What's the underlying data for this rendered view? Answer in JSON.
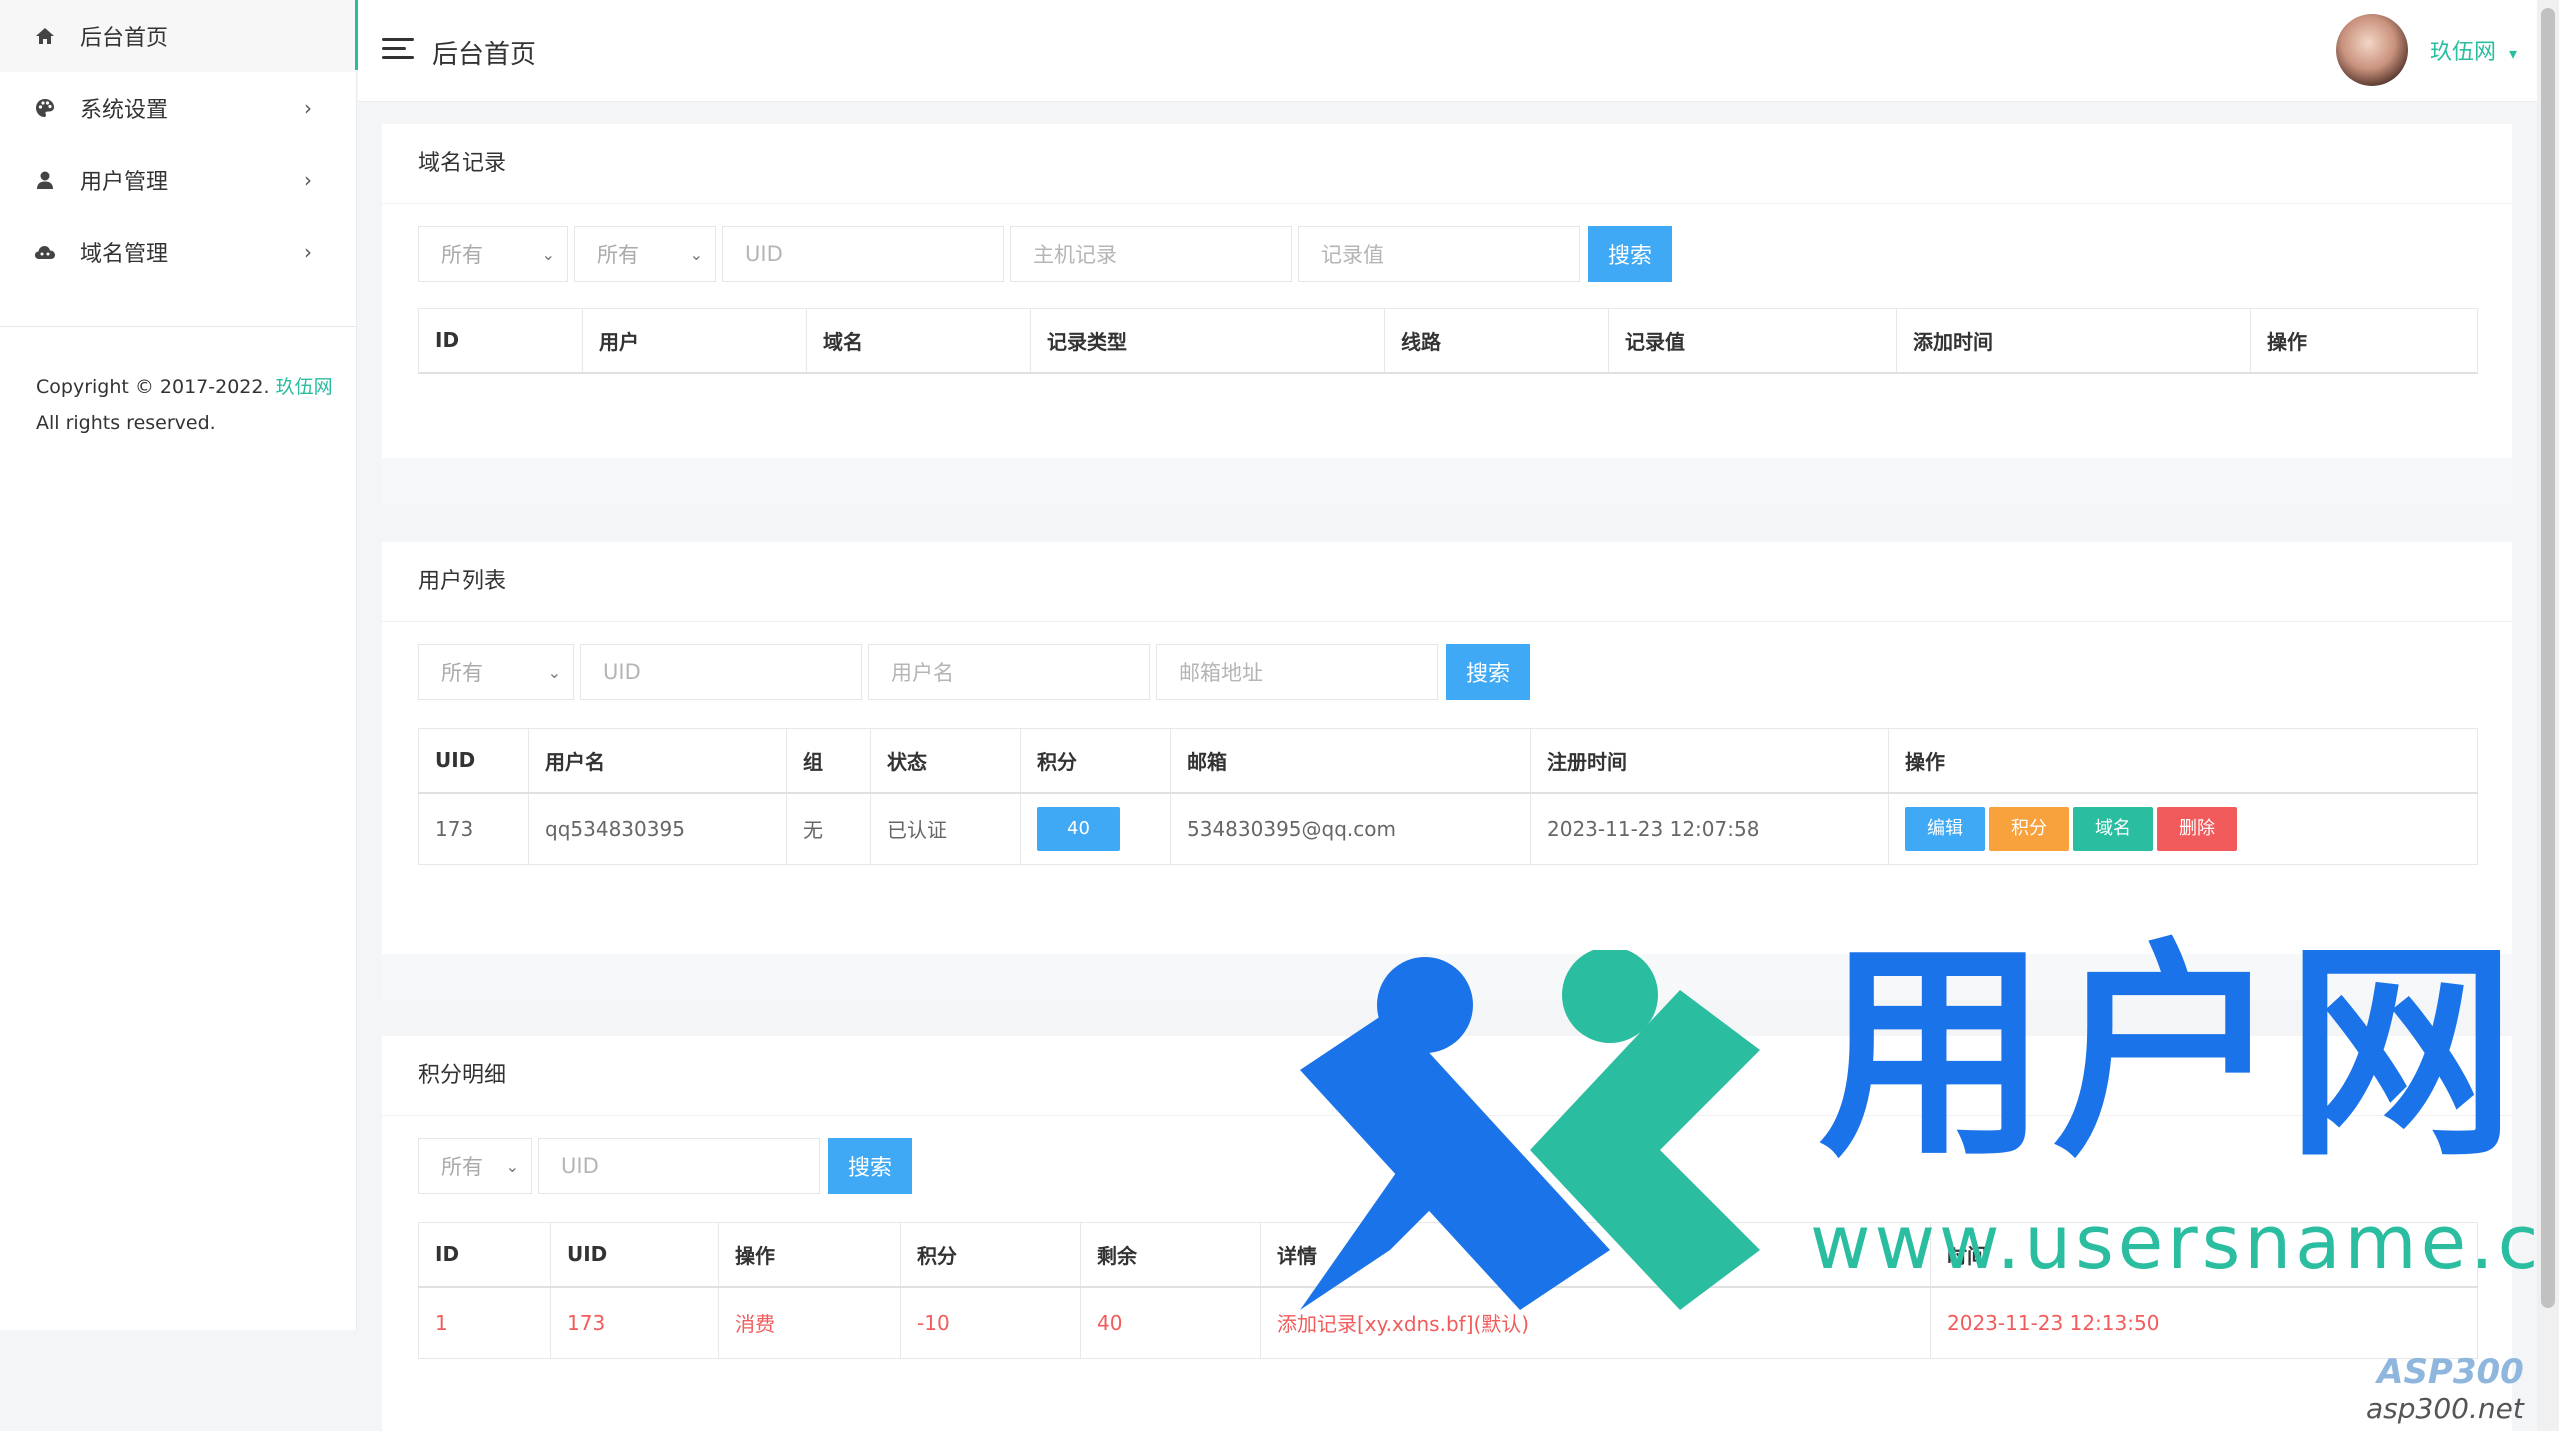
{
  "sidebar": {
    "items": [
      {
        "label": "后台首页",
        "icon": "home-icon",
        "has_chevron": false
      },
      {
        "label": "系统设置",
        "icon": "palette-icon",
        "has_chevron": true
      },
      {
        "label": "用户管理",
        "icon": "user-icon",
        "has_chevron": true
      },
      {
        "label": "域名管理",
        "icon": "cloud-icon",
        "has_chevron": true
      }
    ],
    "chevron": "›",
    "copyright_prefix": "Copyright © 2017-2022. ",
    "copyright_link": "玖伍网",
    "rights": "All rights reserved."
  },
  "header": {
    "title": "后台首页",
    "username": "玖伍网",
    "caret": "▾"
  },
  "domain_records": {
    "title": "域名记录",
    "filters": {
      "select1": "所有",
      "select2": "所有",
      "uid_placeholder": "UID",
      "host_placeholder": "主机记录",
      "value_placeholder": "记录值",
      "search_label": "搜索"
    },
    "columns": [
      "ID",
      "用户",
      "域名",
      "记录类型",
      "线路",
      "记录值",
      "添加时间",
      "操作"
    ]
  },
  "user_list": {
    "title": "用户列表",
    "filters": {
      "select1": "所有",
      "uid_placeholder": "UID",
      "username_placeholder": "用户名",
      "email_placeholder": "邮箱地址",
      "search_label": "搜索"
    },
    "columns": [
      "UID",
      "用户名",
      "组",
      "状态",
      "积分",
      "邮箱",
      "注册时间",
      "操作"
    ],
    "rows": [
      {
        "uid": "173",
        "username": "qq534830395",
        "group": "无",
        "status": "已认证",
        "points": "40",
        "email": "534830395@qq.com",
        "reg_time": "2023-11-23 12:07:58",
        "ops": [
          "编辑",
          "积分",
          "域名",
          "删除"
        ]
      }
    ]
  },
  "points_detail": {
    "title": "积分明细",
    "filters": {
      "select1": "所有",
      "uid_placeholder": "UID",
      "search_label": "搜索"
    },
    "columns": [
      "ID",
      "UID",
      "操作",
      "积分",
      "剩余",
      "详情",
      "时间"
    ],
    "rows": [
      {
        "id": "1",
        "uid": "173",
        "action": "消费",
        "points": "-10",
        "remain": "40",
        "detail": "添加记录[xy.xdns.bf](默认)",
        "time": "2023-11-23 12:13:50"
      }
    ]
  },
  "watermark": {
    "brand": "用户网",
    "url": "www.usersname.cn",
    "corner_brand": "ASP300",
    "corner_url": "asp300.net"
  },
  "colors": {
    "accent": "#2bbd9f",
    "primary_button": "#3fa9f5",
    "warning": "#f7a23d",
    "danger": "#f25b5b"
  }
}
